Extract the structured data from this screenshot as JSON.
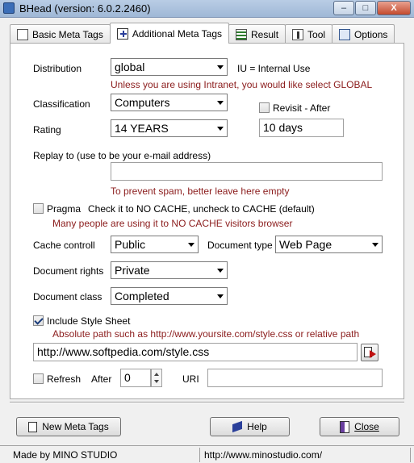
{
  "window": {
    "title": "BHead (version: 6.0.2.2460)",
    "minimize": "–",
    "maximize": "□",
    "close": "X"
  },
  "tabs": [
    {
      "label": "Basic Meta Tags",
      "icon": "document-icon"
    },
    {
      "label": "Additional Meta Tags",
      "icon": "document-plus-icon",
      "active": true
    },
    {
      "label": "Result",
      "icon": "list-icon"
    },
    {
      "label": "Tool",
      "icon": "tool-icon"
    },
    {
      "label": "Options",
      "icon": "options-icon"
    }
  ],
  "form": {
    "distribution": {
      "label": "Distribution",
      "value": "global",
      "note": "IU = Internal Use",
      "hint": "Unless you are using Intranet, you would like select GLOBAL"
    },
    "classification": {
      "label": "Classification",
      "value": "Computers"
    },
    "revisit": {
      "label": "Revisit - After",
      "checked": false,
      "value": "10 days"
    },
    "rating": {
      "label": "Rating",
      "value": "14 YEARS"
    },
    "replay_to": {
      "label": "Replay to (use to be your e-mail address)",
      "value": "",
      "hint": "To prevent spam, better leave here empty"
    },
    "pragma": {
      "label": "Pragma",
      "checked": false,
      "note": "Check it to NO CACHE, uncheck to CACHE (default)",
      "hint": "Many people are using it to NO CACHE visitors browser"
    },
    "cache_control": {
      "label": "Cache controll",
      "value": "Public"
    },
    "document_type": {
      "label": "Document type",
      "value": "Web Page"
    },
    "document_rights": {
      "label": "Document rights",
      "value": "Private"
    },
    "document_class": {
      "label": "Document class",
      "value": "Completed"
    },
    "style_sheet": {
      "label": "Include Style Sheet",
      "checked": true,
      "hint": "Absolute path such as http://www.yoursite.com/style.css or relative path",
      "value": "http://www.softpedia.com/style.css"
    },
    "refresh": {
      "label": "Refresh",
      "checked": false,
      "after_label": "After",
      "after_value": "0",
      "uri_label": "URI",
      "uri_value": ""
    }
  },
  "buttons": {
    "new_meta_tags": "New Meta Tags",
    "help": "Help",
    "close": "Close"
  },
  "status": {
    "made_by": "Made by MINO STUDIO",
    "url": "http://www.minostudio.com/"
  },
  "colors": {
    "hint_text": "#8b1c1c",
    "panel_bg": "#ffffff",
    "window_bg": "#f0f0f0"
  }
}
